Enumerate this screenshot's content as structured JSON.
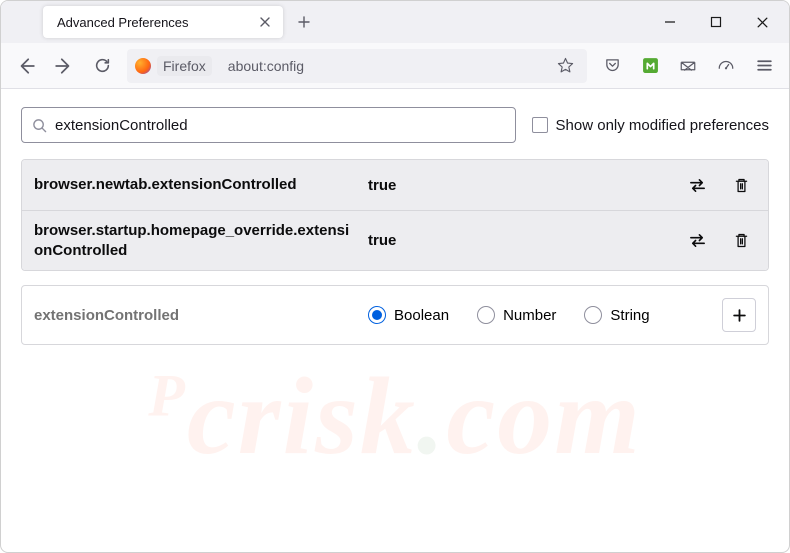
{
  "titlebar": {
    "tab_title": "Advanced Preferences"
  },
  "toolbar": {
    "identity_label": "Firefox",
    "url": "about:config"
  },
  "search": {
    "value": "extensionControlled",
    "placeholder": ""
  },
  "show_only_modified_label": "Show only modified preferences",
  "prefs": [
    {
      "name": "browser.newtab.extensionControlled",
      "value": "true"
    },
    {
      "name": "browser.startup.homepage_override.extensionControlled",
      "value": "true"
    }
  ],
  "new_pref": {
    "name": "extensionControlled",
    "types": [
      "Boolean",
      "Number",
      "String"
    ],
    "selected": "Boolean"
  },
  "watermark": {
    "prefix": "P",
    "main": "crisk",
    "dot": ".",
    "suffix": "com"
  }
}
